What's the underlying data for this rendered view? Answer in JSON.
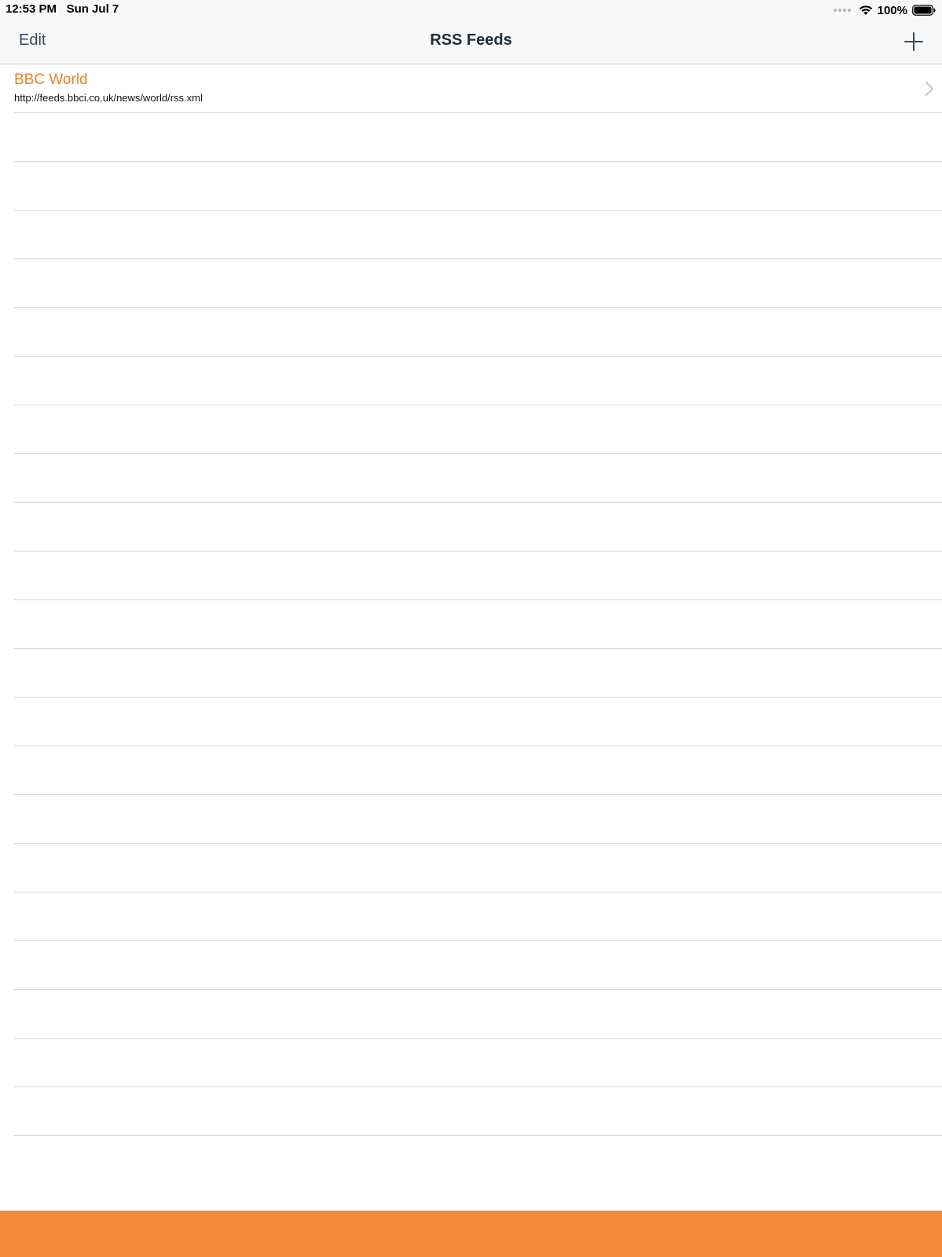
{
  "status_bar": {
    "time": "12:53 PM",
    "date": "Sun Jul 7",
    "battery_percent": "100%",
    "icons": [
      "signal-dots-icon",
      "wifi-icon",
      "battery-icon"
    ]
  },
  "nav_bar": {
    "edit_label": "Edit",
    "title": "RSS Feeds",
    "add_icon": "plus-icon"
  },
  "feeds": [
    {
      "title": "BBC World",
      "url": "http://feeds.bbci.co.uk/news/world/rss.xml",
      "accessory_icon": "chevron-right-icon"
    }
  ],
  "colors": {
    "accent": "#e8832a",
    "bottom_bar": "#f38a39",
    "nav_text": "#34495e",
    "nav_background": "#f8f8f8",
    "separator": "#d9d9dc"
  }
}
